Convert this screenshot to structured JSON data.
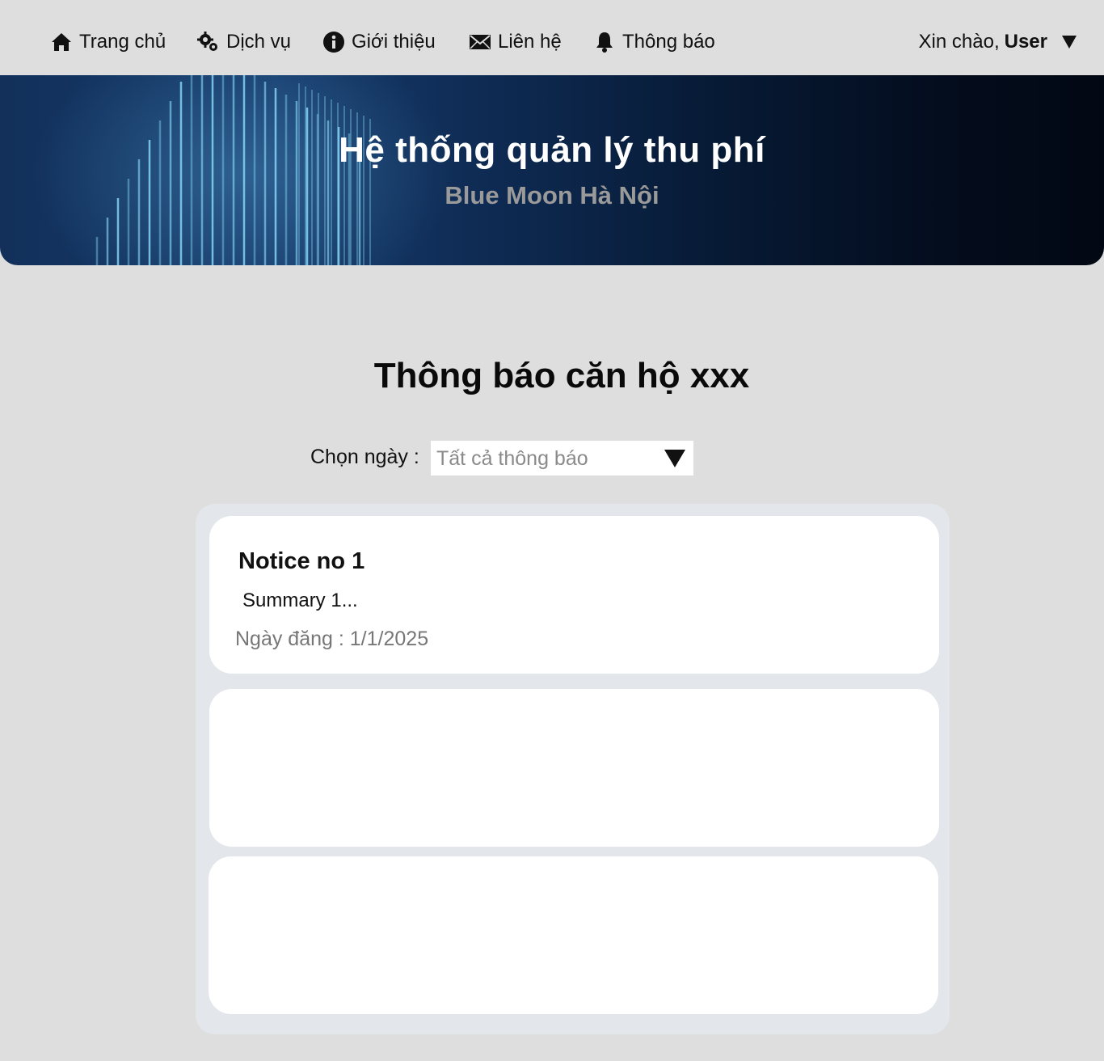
{
  "nav": {
    "items": [
      {
        "label": "Trang chủ",
        "icon": "home-icon"
      },
      {
        "label": "Dịch vụ",
        "icon": "gears-icon"
      },
      {
        "label": "Giới thiệu",
        "icon": "info-icon"
      },
      {
        "label": "Liên hệ",
        "icon": "envelope-icon"
      },
      {
        "label": "Thông báo",
        "icon": "bell-icon"
      }
    ],
    "greeting": "Xin chào,",
    "user_name": "User"
  },
  "banner": {
    "title": "Hệ thống quản lý thu phí",
    "subtitle": "Blue Moon Hà Nội"
  },
  "main": {
    "title": "Thông báo căn hộ xxx",
    "filter_label": "Chọn ngày :",
    "filter_value": "Tất cả thông báo"
  },
  "notices": [
    {
      "title": "Notice no 1",
      "summary": "Summary 1...",
      "date_label": "Ngày đăng :",
      "date": "1/1/2025"
    },
    {
      "title": "",
      "summary": "",
      "date_label": "",
      "date": ""
    },
    {
      "title": "",
      "summary": "",
      "date_label": "",
      "date": ""
    }
  ],
  "colors": {
    "background": "#dedede",
    "banner_dark": "#020813",
    "banner_blue": "#163b6c",
    "card": "#ffffff",
    "list_bg": "#e3e7eb"
  }
}
